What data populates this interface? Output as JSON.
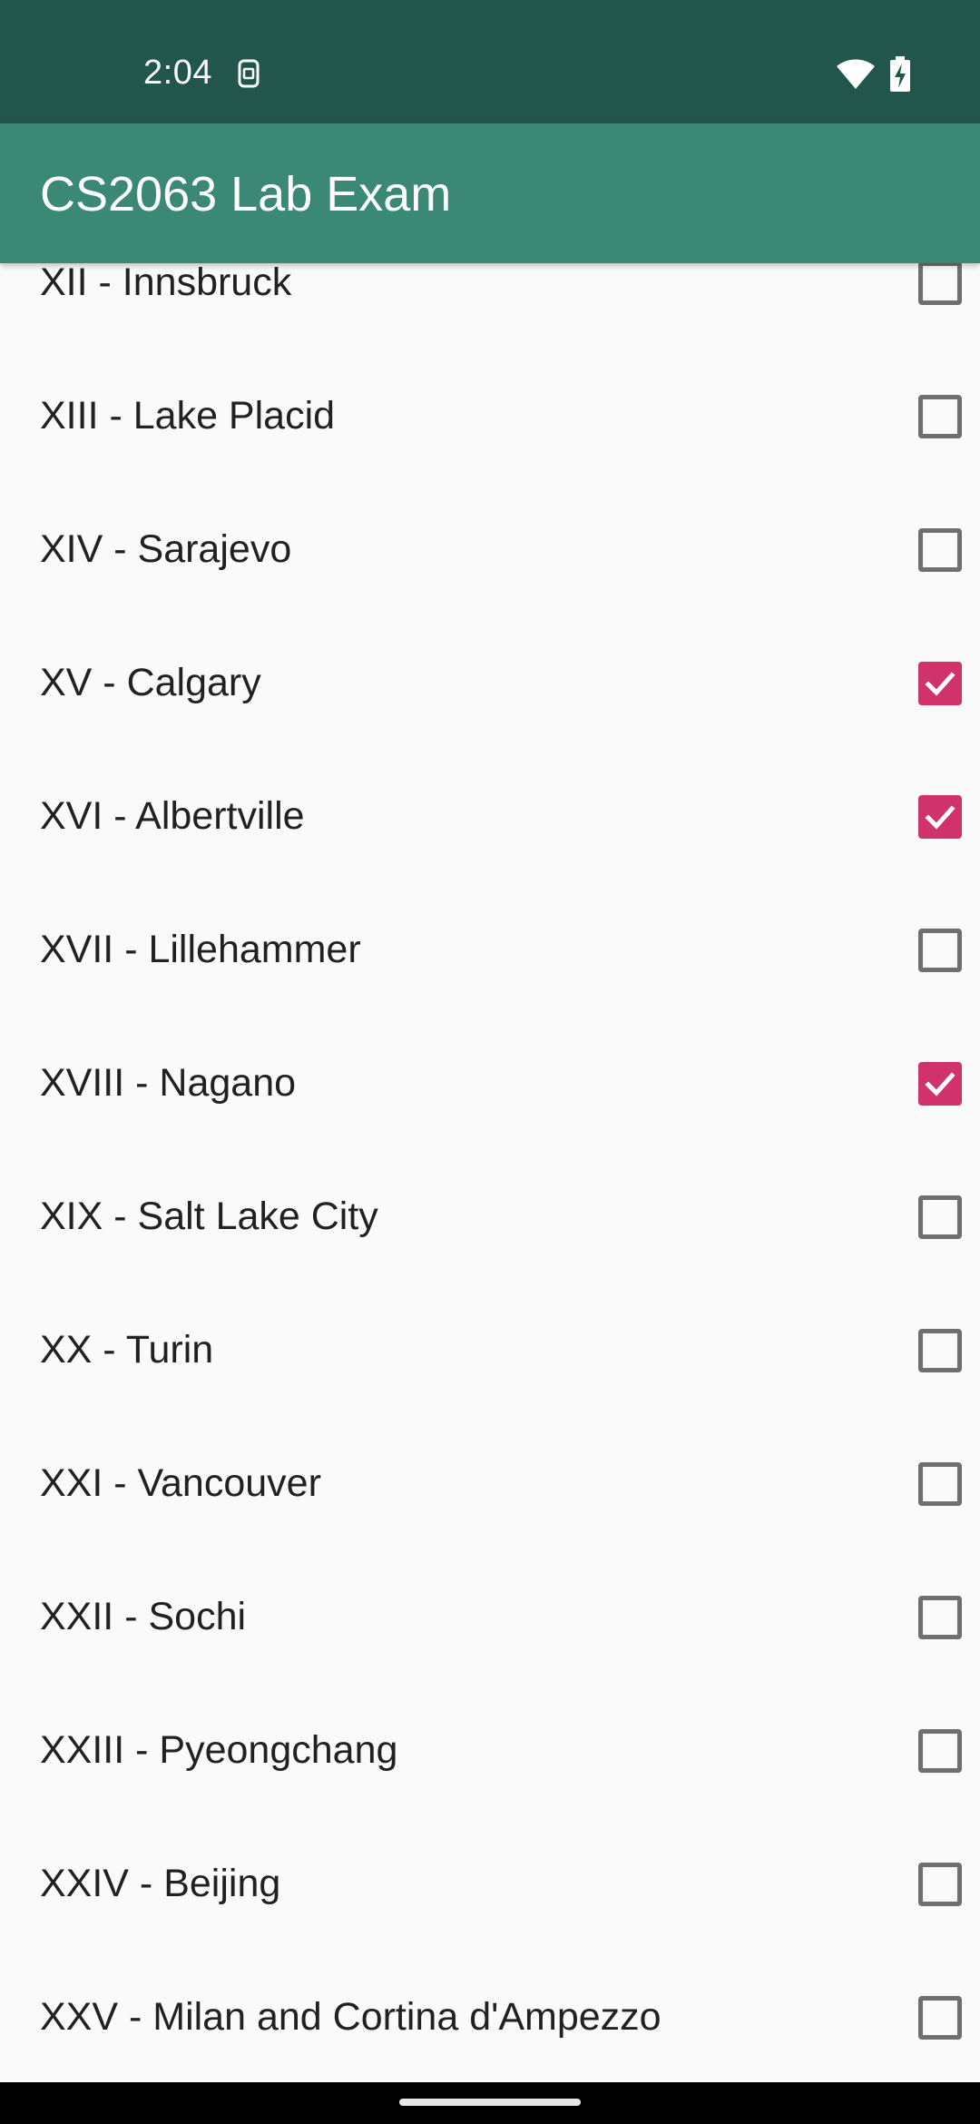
{
  "status_bar": {
    "time": "2:04",
    "background_color": "#22554c",
    "icons": [
      "sim-card-icon",
      "wifi-icon",
      "battery-charging-icon"
    ]
  },
  "app_bar": {
    "title": "CS2063 Lab Exam",
    "background_color": "#3c8877"
  },
  "list": {
    "accent_color": "#d0336a",
    "items": [
      {
        "label": "XII - Innsbruck",
        "checked": false
      },
      {
        "label": "XIII - Lake Placid",
        "checked": false
      },
      {
        "label": "XIV - Sarajevo",
        "checked": false
      },
      {
        "label": "XV - Calgary",
        "checked": true
      },
      {
        "label": "XVI - Albertville",
        "checked": true
      },
      {
        "label": "XVII - Lillehammer",
        "checked": false
      },
      {
        "label": "XVIII - Nagano",
        "checked": true
      },
      {
        "label": "XIX - Salt Lake City",
        "checked": false
      },
      {
        "label": "XX - Turin",
        "checked": false
      },
      {
        "label": "XXI - Vancouver",
        "checked": false
      },
      {
        "label": "XXII - Sochi",
        "checked": false
      },
      {
        "label": "XXIII - Pyeongchang",
        "checked": false
      },
      {
        "label": "XXIV - Beijing",
        "checked": false
      },
      {
        "label": "XXV - Milan and Cortina d'Ampezzo",
        "checked": false
      }
    ]
  }
}
